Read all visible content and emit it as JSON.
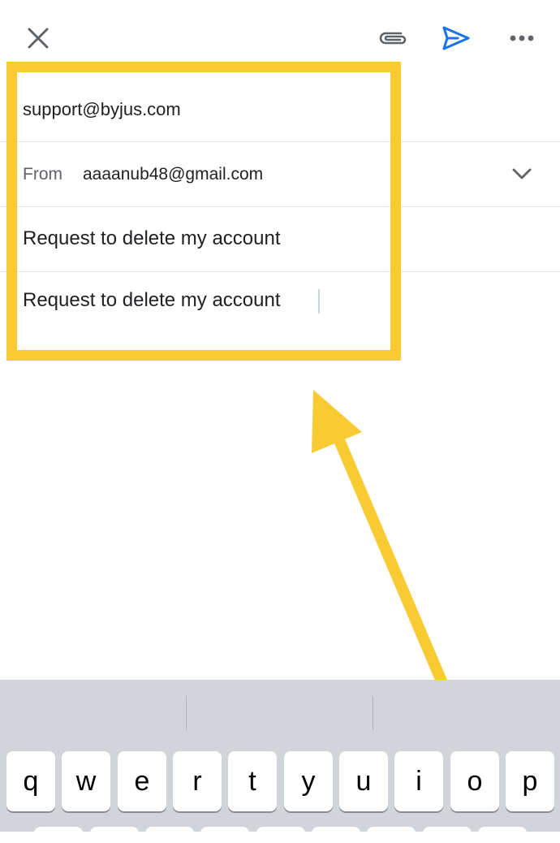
{
  "compose": {
    "to": "support@byjus.com",
    "from_label": "From",
    "from_value": "aaaanub48@gmail.com",
    "subject": "Request to delete my account",
    "body": "Request to delete my account"
  },
  "toolbar": {
    "icons": [
      "close-icon",
      "attach-icon",
      "send-icon",
      "more-icon"
    ]
  },
  "annotation": {
    "highlight_color": "#f9cb32"
  },
  "colors": {
    "send_blue": "#1a73e8",
    "keyboard_bg": "#d1d4d9"
  },
  "keyboard": {
    "row1": [
      "q",
      "w",
      "e",
      "r",
      "t",
      "y",
      "u",
      "i",
      "o",
      "p"
    ]
  }
}
